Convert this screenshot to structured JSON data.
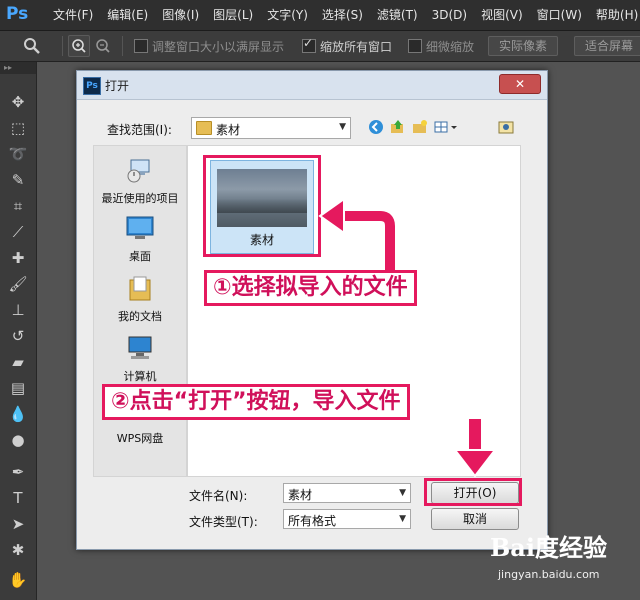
{
  "app": {
    "logo": "Ps",
    "menus": [
      "文件(F)",
      "编辑(E)",
      "图像(I)",
      "图层(L)",
      "文字(Y)",
      "选择(S)",
      "滤镜(T)",
      "3D(D)",
      "视图(V)",
      "窗口(W)",
      "帮助(H)"
    ]
  },
  "options": {
    "resize_windows_label": "调整窗口大小以满屏显示",
    "zoom_all_label": "缩放所有窗口",
    "scrubby_label": "细微缩放",
    "actual_pixels": "实际像素",
    "fit_screen": "适合屏幕"
  },
  "dialog": {
    "title": "打开",
    "close": "✕",
    "look_in_label": "查找范围(I):",
    "look_in_value": "素材",
    "places": [
      "最近使用的项目",
      "桌面",
      "我的文档",
      "计算机",
      "WPS网盘"
    ],
    "file": {
      "name": "素材"
    },
    "filename_label": "文件名(N):",
    "filename_value": "素材",
    "filetype_label": "文件类型(T):",
    "filetype_value": "所有格式",
    "open_button": "打开(O)",
    "cancel_button": "取消"
  },
  "annotations": {
    "step1": "①选择拟导入的文件",
    "step2": "②点击“打开”按钮，导入文件"
  },
  "watermark": {
    "brand": "Bai度经验",
    "url": "jingyan.baidu.com"
  },
  "colors": {
    "accent": "#e5195e",
    "selection": "#cce4f7",
    "ps_blue": "#4aa8ff"
  }
}
